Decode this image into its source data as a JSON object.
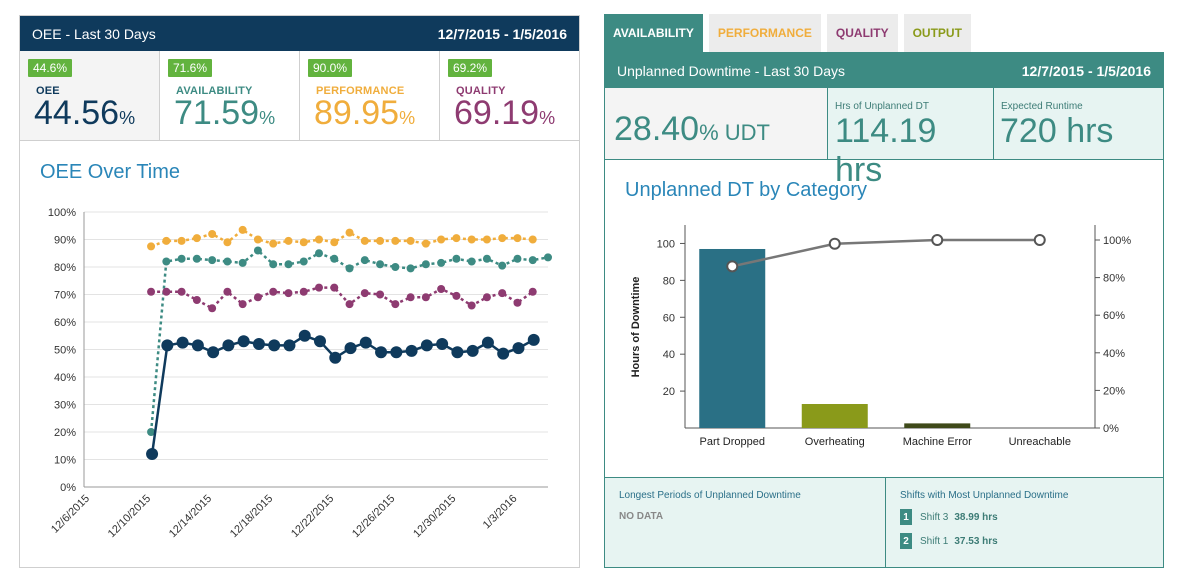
{
  "left": {
    "header_title": "OEE - Last 30 Days",
    "header_range": "12/7/2015 - 1/5/2016",
    "kpis": [
      {
        "badge": "44.6%",
        "label": "OEE",
        "value": "44.56",
        "unit": "%",
        "color": "#0f3a5c"
      },
      {
        "badge": "71.6%",
        "label": "AVAILABILITY",
        "value": "71.59",
        "unit": "%",
        "color": "#3d8b83"
      },
      {
        "badge": "90.0%",
        "label": "PERFORMANCE",
        "value": "89.95",
        "unit": "%",
        "color": "#f0ad3c"
      },
      {
        "badge": "69.2%",
        "label": "QUALITY",
        "value": "69.19",
        "unit": "%",
        "color": "#8e3b71"
      }
    ],
    "chart_title": "OEE Over Time"
  },
  "tabs": [
    {
      "label": "AVAILABILITY",
      "active": true,
      "color": "#ffffff"
    },
    {
      "label": "PERFORMANCE",
      "active": false,
      "color": "#f0ad3c"
    },
    {
      "label": "QUALITY",
      "active": false,
      "color": "#8e3b71"
    },
    {
      "label": "OUTPUT",
      "active": false,
      "color": "#8a9a1a"
    }
  ],
  "right": {
    "header_title": "Unplanned Downtime - Last 30 Days",
    "header_range": "12/7/2015 - 1/5/2016",
    "udt_value": "28.40",
    "udt_unit": "% UDT",
    "hrs_label": "Hrs of Unplanned DT",
    "hrs_value": "114.19",
    "hrs_unit": "hrs",
    "runtime_label": "Expected Runtime",
    "runtime_value": "720",
    "runtime_unit": "hrs",
    "chart_title": "Unplanned DT by Category",
    "longest_title": "Longest Periods of Unplanned Downtime",
    "longest_value": "NO DATA",
    "shifts_title": "Shifts with Most Unplanned Downtime",
    "shifts": [
      {
        "rank": "1",
        "name": "Shift 3",
        "hours": "38.99 hrs"
      },
      {
        "rank": "2",
        "name": "Shift 1",
        "hours": "37.53 hrs"
      }
    ]
  },
  "chart_data": [
    {
      "type": "line",
      "title": "OEE Over Time",
      "x_dates": [
        "12/10/2015",
        "12/11/2015",
        "12/12/2015",
        "12/13/2015",
        "12/14/2015",
        "12/15/2015",
        "12/16/2015",
        "12/17/2015",
        "12/18/2015",
        "12/19/2015",
        "12/20/2015",
        "12/21/2015",
        "12/22/2015",
        "12/23/2015",
        "12/24/2015",
        "12/25/2015",
        "12/26/2015",
        "12/27/2015",
        "12/28/2015",
        "12/29/2015",
        "12/30/2015",
        "12/31/2015",
        "1/1/2016",
        "1/2/2016",
        "1/3/2016",
        "1/4/2016",
        "1/5/2016"
      ],
      "tick_labels": [
        "12/6/2015",
        "12/10/2015",
        "12/14/2015",
        "12/18/2015",
        "12/22/2015",
        "12/26/2015",
        "12/30/2015",
        "1/3/2016"
      ],
      "ylim": [
        0,
        100
      ],
      "yticks": [
        "0%",
        "10%",
        "20%",
        "30%",
        "40%",
        "50%",
        "60%",
        "70%",
        "80%",
        "90%",
        "100%"
      ],
      "grid": true,
      "series": [
        {
          "color": "#f0ad3c",
          "dash": true,
          "values": [
            87.5,
            89.5,
            89.5,
            90.5,
            92,
            89,
            93.5,
            90,
            88.5,
            89.5,
            89,
            90,
            89,
            92.5,
            89.5,
            89.5,
            89.5,
            89.5,
            88.5,
            90,
            90.5,
            90,
            90,
            90.5,
            90.5,
            90
          ],
          "x_start": 0
        },
        {
          "color": "#3d8b83",
          "dash": true,
          "values": [
            20,
            82,
            83,
            83,
            82.5,
            82,
            81.5,
            86,
            81,
            81,
            82,
            85,
            83,
            79.5,
            82.5,
            81,
            80,
            79.5,
            81,
            81.5,
            83,
            82,
            83,
            80.5,
            83,
            82.5,
            83.5
          ],
          "x_start": 0
        },
        {
          "color": "#8e3b71",
          "dash": true,
          "values": [
            71,
            71,
            71,
            68,
            65,
            71,
            66.5,
            69,
            71,
            70.5,
            71,
            72.5,
            72.5,
            66.5,
            70.5,
            70,
            66.5,
            69,
            69,
            72,
            69.5,
            66,
            69,
            70.5,
            67,
            71
          ],
          "x_start": 0
        },
        {
          "color": "#0f3a5c",
          "dash": false,
          "values": [
            12,
            51.5,
            52.5,
            51.5,
            49,
            51.5,
            53,
            52,
            51.5,
            51.5,
            55,
            53,
            47,
            50.5,
            52.5,
            49,
            49,
            49.5,
            51.5,
            52,
            49,
            49.5,
            52.5,
            48.5,
            50.5,
            53.5
          ],
          "x_start": 0
        }
      ]
    },
    {
      "type": "bar",
      "title": "Unplanned DT by Category",
      "categories": [
        "Part Dropped",
        "Overheating",
        "Machine Error",
        "Unreachable"
      ],
      "values": [
        97,
        13,
        2.5,
        0
      ],
      "bar_colors": [
        "#2a7085",
        "#8a9a1a",
        "#3f4a1a",
        "#2a7085"
      ],
      "ylabel": "Hours of Downtime",
      "ylim": [
        0,
        110
      ],
      "yticks": [
        20,
        40,
        60,
        80,
        100
      ],
      "cumulative_pct": [
        86,
        98,
        100,
        100
      ],
      "y2ticks": [
        "0%",
        "20%",
        "40%",
        "60%",
        "80%",
        "100%"
      ]
    }
  ]
}
